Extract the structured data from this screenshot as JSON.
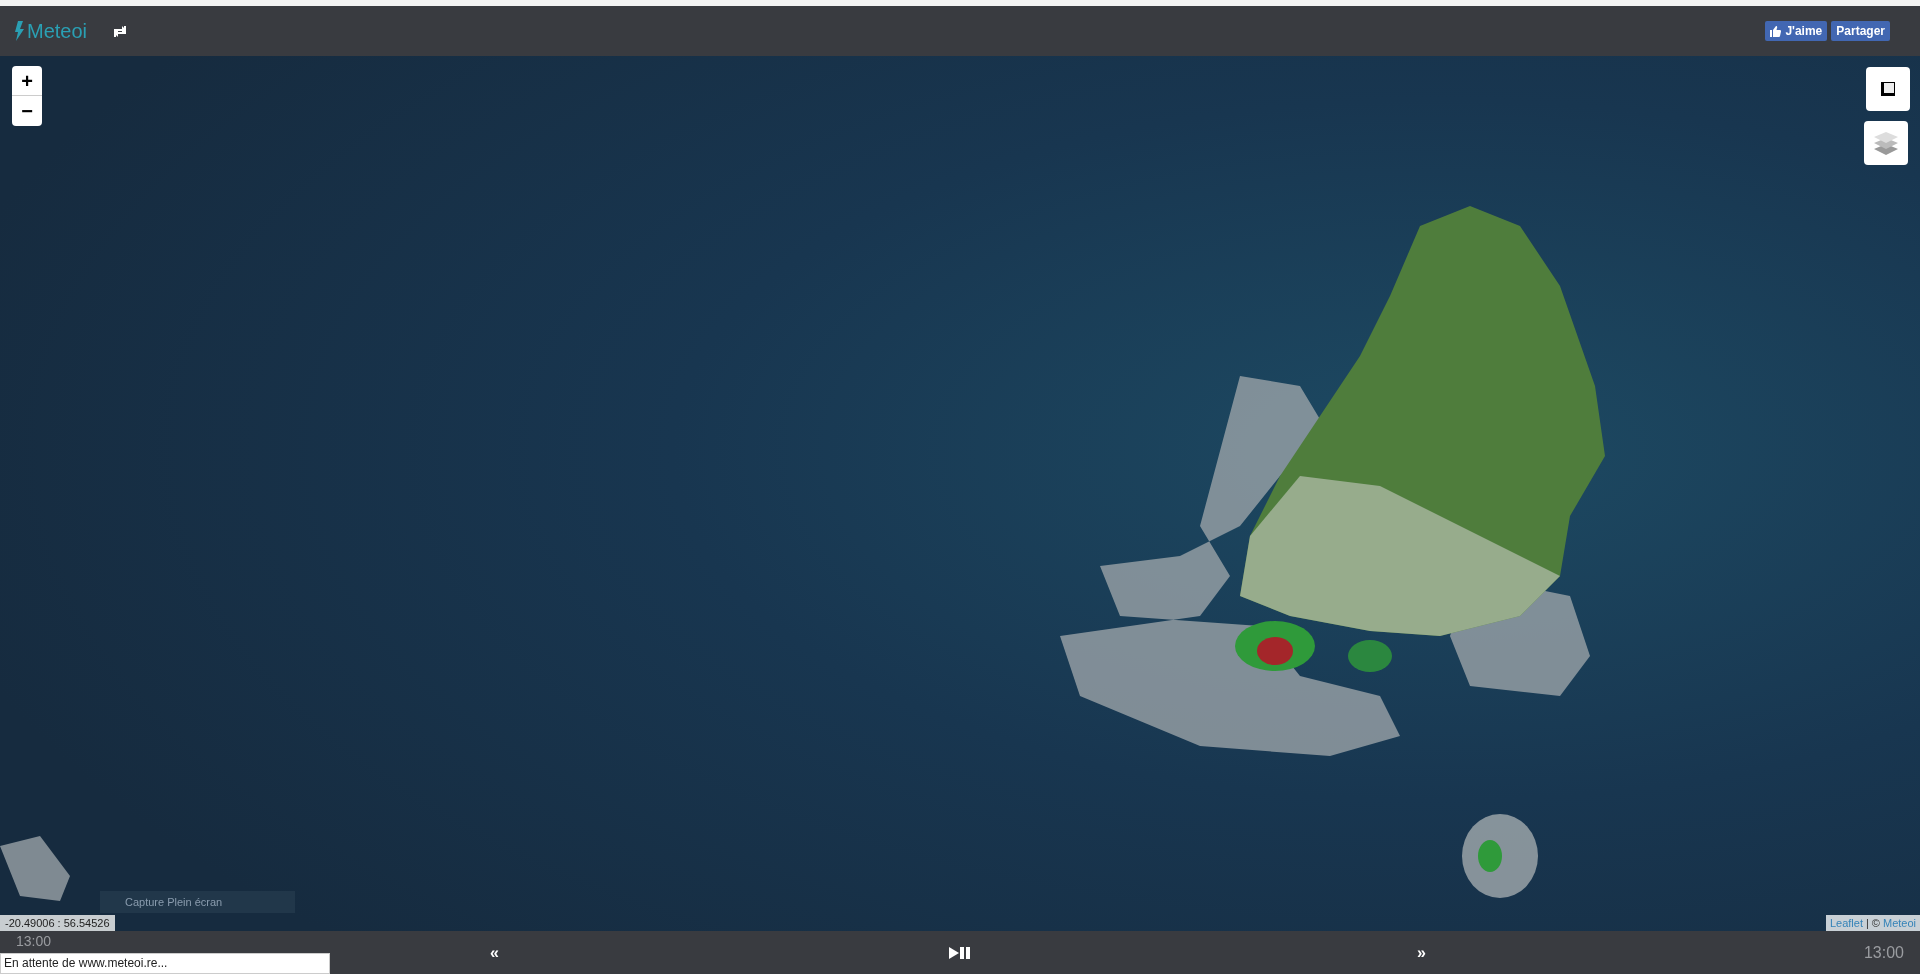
{
  "header": {
    "brand": "Meteoi",
    "like_button": "J'aime",
    "share_button": "Partager"
  },
  "map": {
    "zoom_in": "+",
    "zoom_out": "−",
    "coordinates": "-20.49006 : 56.54526",
    "capture_button": "Capture Plein écran",
    "attribution": {
      "link": "Leaflet",
      "separator": "| ©",
      "owner": "Meteoi"
    }
  },
  "player": {
    "start_time": "13:00",
    "prev": "«",
    "next": "»",
    "end_time": "13:00"
  },
  "status_bar": {
    "text": "En attente de www.meteoi.re..."
  }
}
